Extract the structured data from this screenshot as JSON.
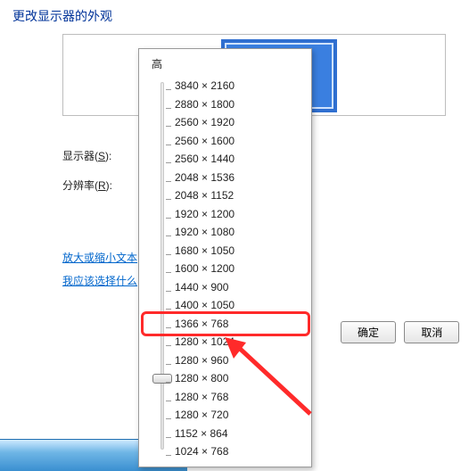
{
  "title": "更改显示器的外观",
  "labels": {
    "display": "显示器(",
    "display_key": "S",
    "display_suffix": "):",
    "resolution": "分辨率(",
    "resolution_key": "R",
    "resolution_suffix": "):"
  },
  "links": {
    "scale_text": "放大或缩小文本",
    "what_choose": "我应该选择什么"
  },
  "buttons": {
    "ok": "确定",
    "cancel": "取消"
  },
  "dropdown": {
    "high": "高",
    "resolutions": [
      "3840 × 2160",
      "2880 × 1800",
      "2560 × 1920",
      "2560 × 1600",
      "2560 × 1440",
      "2048 × 1536",
      "2048 × 1152",
      "1920 × 1200",
      "1920 × 1080",
      "1680 × 1050",
      "1600 × 1200",
      "1440 × 900",
      "1400 × 1050",
      "1366 × 768",
      "1280 × 1024",
      "1280 × 960",
      "1280 × 800",
      "1280 × 768",
      "1280 × 720",
      "1152 × 864",
      "1024 × 768"
    ],
    "selected_index": 16
  }
}
